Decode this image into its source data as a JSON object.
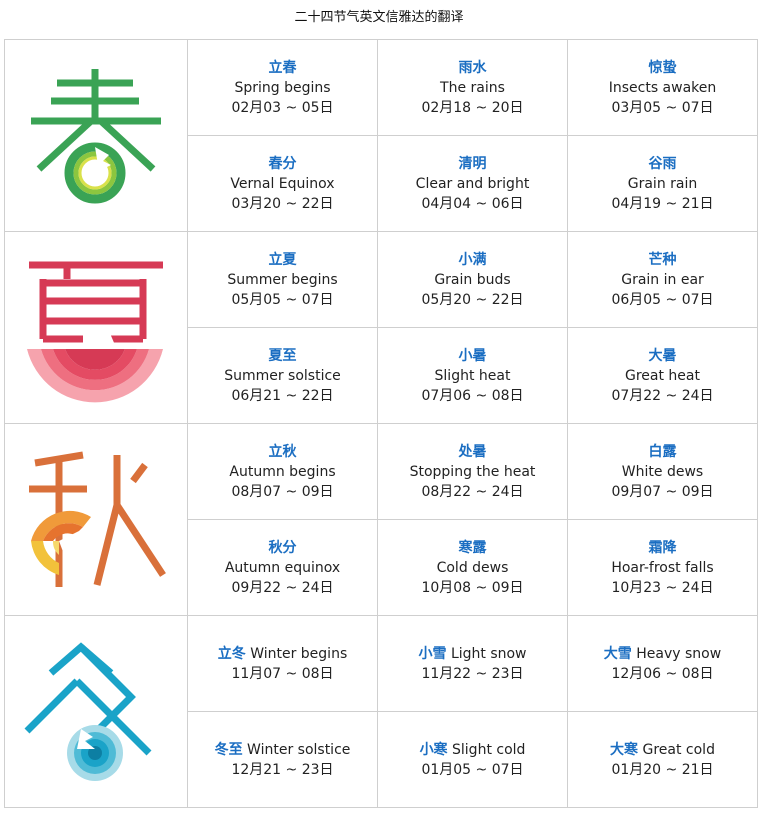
{
  "title": "二十四节气英文信雅达的翻译",
  "seasons": [
    {
      "glyph": "春",
      "glyph_color": "#3aa355",
      "terms": [
        {
          "cn": "立春",
          "en": "Spring begins",
          "date": "02月03 ~ 05日"
        },
        {
          "cn": "雨水",
          "en": "The rains",
          "date": "02月18 ~ 20日"
        },
        {
          "cn": "惊蛰",
          "en": "Insects awaken",
          "date": "03月05 ~ 07日"
        },
        {
          "cn": "春分",
          "en": "Vernal Equinox",
          "date": "03月20 ~ 22日"
        },
        {
          "cn": "清明",
          "en": "Clear and bright",
          "date": "04月04 ~ 06日"
        },
        {
          "cn": "谷雨",
          "en": "Grain rain",
          "date": "04月19 ~ 21日"
        }
      ]
    },
    {
      "glyph": "夏",
      "glyph_color": "#d63a55",
      "terms": [
        {
          "cn": "立夏",
          "en": "Summer begins",
          "date": "05月05 ~ 07日"
        },
        {
          "cn": "小满",
          "en": "Grain buds",
          "date": "05月20 ~ 22日"
        },
        {
          "cn": "芒种",
          "en": "Grain in ear",
          "date": "06月05 ~ 07日"
        },
        {
          "cn": "夏至",
          "en": "Summer solstice",
          "date": "06月21 ~ 22日"
        },
        {
          "cn": "小暑",
          "en": "Slight heat",
          "date": "07月06 ~ 08日"
        },
        {
          "cn": "大暑",
          "en": "Great heat",
          "date": "07月22 ~ 24日"
        }
      ]
    },
    {
      "glyph": "秋",
      "glyph_color": "#d9703a",
      "terms": [
        {
          "cn": "立秋",
          "en": "Autumn begins",
          "date": "08月07 ~ 09日"
        },
        {
          "cn": "处暑",
          "en": "Stopping the heat",
          "date": "08月22 ~ 24日"
        },
        {
          "cn": "白露",
          "en": "White dews",
          "date": "09月07 ~ 09日"
        },
        {
          "cn": "秋分",
          "en": "Autumn equinox",
          "date": "09月22 ~ 24日"
        },
        {
          "cn": "寒露",
          "en": "Cold dews",
          "date": "10月08 ~ 09日"
        },
        {
          "cn": "霜降",
          "en": "Hoar-frost falls",
          "date": "10月23 ~ 24日"
        }
      ]
    },
    {
      "glyph": "冬",
      "glyph_color": "#1aa3c8",
      "terms": [
        {
          "cn": "立冬",
          "en": "Winter begins",
          "date": "11月07 ~ 08日"
        },
        {
          "cn": "小雪",
          "en": "Light snow",
          "date": "11月22 ~ 23日"
        },
        {
          "cn": "大雪",
          "en": "Heavy snow",
          "date": "12月06 ~ 08日"
        },
        {
          "cn": "冬至",
          "en": "Winter solstice",
          "date": "12月21 ~ 23日"
        },
        {
          "cn": "小寒",
          "en": "Slight cold",
          "date": "01月05 ~ 07日"
        },
        {
          "cn": "大寒",
          "en": "Great cold",
          "date": "01月20 ~ 21日"
        }
      ]
    }
  ]
}
